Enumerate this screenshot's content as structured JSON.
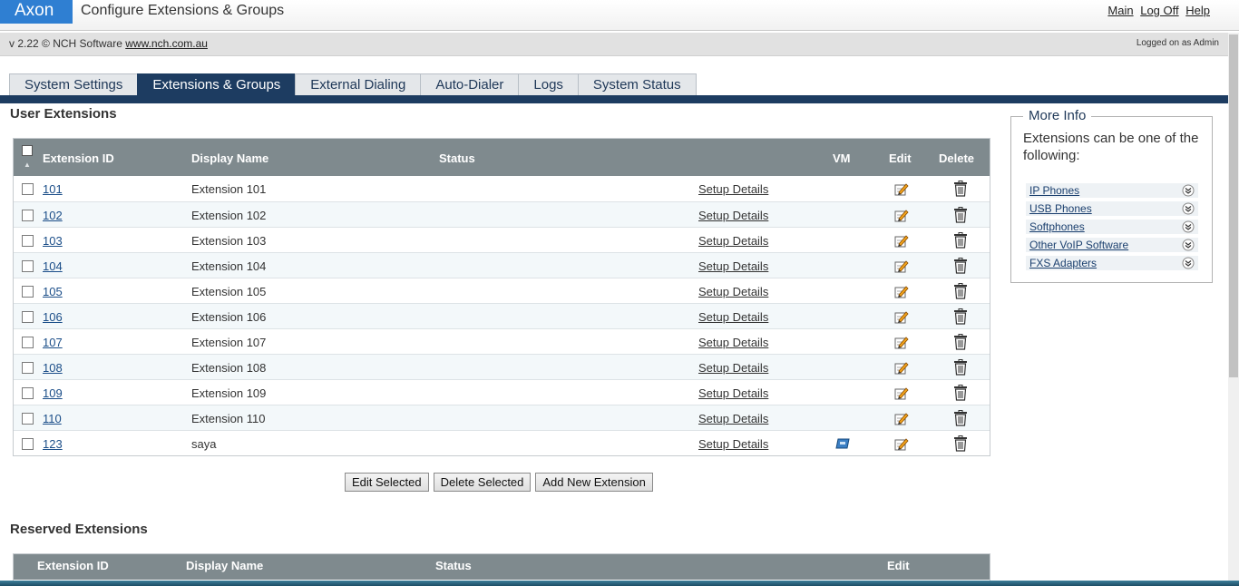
{
  "header": {
    "logo": "Axon",
    "title": "Configure Extensions & Groups",
    "links": [
      "Main",
      "Log Off",
      "Help"
    ]
  },
  "version_bar": {
    "version": "v 2.22 © NCH Software",
    "site": "www.nch.com.au",
    "logged": "Logged on as Admin"
  },
  "tabs": [
    "System Settings",
    "Extensions & Groups",
    "External Dialing",
    "Auto-Dialer",
    "Logs",
    "System Status"
  ],
  "active_tab": 1,
  "user_extensions": {
    "title": "User Extensions",
    "columns": {
      "id": "Extension ID",
      "name": "Display Name",
      "status": "Status",
      "vm": "VM",
      "edit": "Edit",
      "delete": "Delete"
    },
    "rows": [
      {
        "id": "101",
        "name": "Extension 101",
        "details": "Setup Details",
        "vm": false
      },
      {
        "id": "102",
        "name": "Extension 102",
        "details": "Setup Details",
        "vm": false
      },
      {
        "id": "103",
        "name": "Extension 103",
        "details": "Setup Details",
        "vm": false
      },
      {
        "id": "104",
        "name": "Extension 104",
        "details": "Setup Details",
        "vm": false
      },
      {
        "id": "105",
        "name": "Extension 105",
        "details": "Setup Details",
        "vm": false
      },
      {
        "id": "106",
        "name": "Extension 106",
        "details": "Setup Details",
        "vm": false
      },
      {
        "id": "107",
        "name": "Extension 107",
        "details": "Setup Details",
        "vm": false
      },
      {
        "id": "108",
        "name": "Extension 108",
        "details": "Setup Details",
        "vm": false
      },
      {
        "id": "109",
        "name": "Extension 109",
        "details": "Setup Details",
        "vm": false
      },
      {
        "id": "110",
        "name": "Extension 110",
        "details": "Setup Details",
        "vm": false
      },
      {
        "id": "123",
        "name": "saya",
        "details": "Setup Details",
        "vm": true
      }
    ]
  },
  "buttons": {
    "edit_selected": "Edit Selected",
    "delete_selected": "Delete Selected",
    "add_new": "Add New Extension"
  },
  "reserved_extensions": {
    "title": "Reserved Extensions",
    "columns": {
      "id": "Extension ID",
      "name": "Display Name",
      "status": "Status",
      "edit": "Edit"
    }
  },
  "more_info": {
    "title": "More Info",
    "text": "Extensions can be one of the following:",
    "items": [
      "IP Phones",
      "USB Phones",
      "Softphones",
      "Other VoIP Software",
      "FXS Adapters"
    ]
  },
  "colors": {
    "logo": "#2f7fd2",
    "tab_active": "#1d3c61",
    "grid_header": "#7f8a8e"
  },
  "icons": {
    "edit": "pencil-paper-icon",
    "delete": "trash-can-icon",
    "vm": "voicemail-icon",
    "more": "double-chevron-down-icon"
  }
}
